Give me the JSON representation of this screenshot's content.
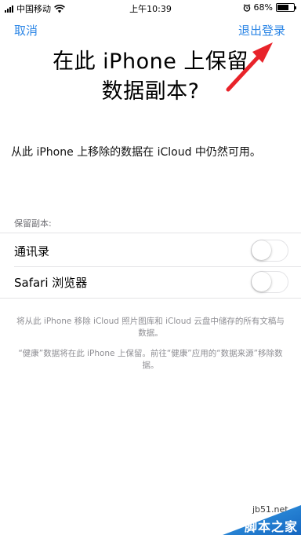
{
  "status_bar": {
    "carrier": "中国移动",
    "time": "上午10:39",
    "battery": "68%",
    "battery_level": 0.68,
    "icons": [
      "signal-icon",
      "wifi-icon",
      "alarm-icon",
      "battery-icon"
    ]
  },
  "nav": {
    "cancel_label": "取消",
    "logout_label": "退出登录"
  },
  "title": {
    "line1": "在此 iPhone 上保留",
    "line2": "数据副本?"
  },
  "description": "从此 iPhone 上移除的数据在 iCloud 中仍然可用。",
  "section_header": "保留副本:",
  "rows": [
    {
      "label": "通讯录",
      "on": false
    },
    {
      "label": "Safari 浏览器",
      "on": false
    }
  ],
  "footnotes": [
    "将从此 iPhone 移除 iCloud 照片图库和 iCloud 云盘中储存的所有文稿与数据。",
    "“健康”数据将在此 iPhone 上保留。前往“健康”应用的“数据来源”移除数据。"
  ],
  "watermark": {
    "url": "jb51.net",
    "text": "脚本之家"
  },
  "colors": {
    "accent": "#2c86e6",
    "annotation_arrow": "#e8232a",
    "secondary_text": "#8e8e93"
  }
}
